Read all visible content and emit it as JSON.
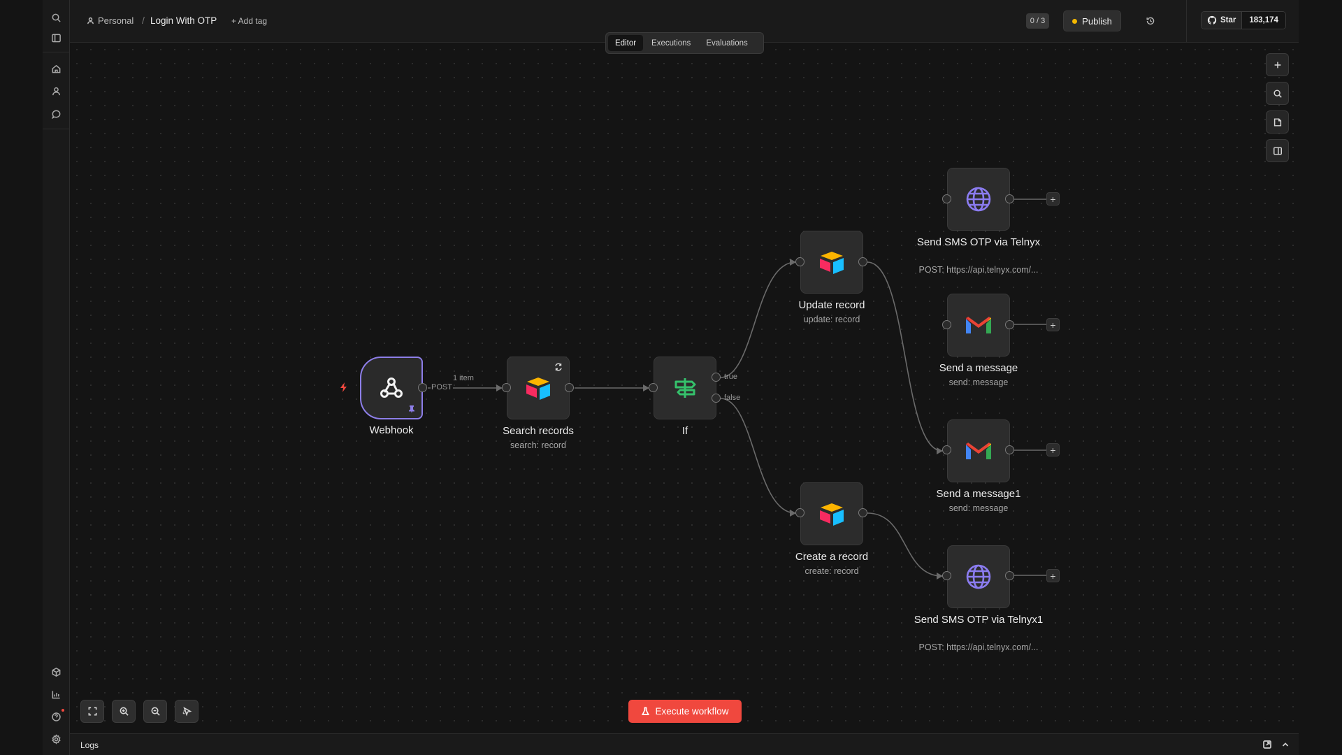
{
  "header": {
    "project": "Personal",
    "workflow_name": "Login With OTP",
    "add_tag": "+ Add tag",
    "counter": "0 / 3",
    "publish_label": "Publish",
    "github_star": "Star",
    "github_count": "183,174"
  },
  "tabs": [
    "Editor",
    "Executions",
    "Evaluations"
  ],
  "active_tab": "Editor",
  "nodes": {
    "webhook": {
      "title": "Webhook",
      "icon": "webhook-icon"
    },
    "search": {
      "title": "Search records",
      "subtitle": "search: record",
      "icon": "airtable-icon"
    },
    "if": {
      "title": "If",
      "icon": "signpost-icon"
    },
    "update": {
      "title": "Update record",
      "subtitle": "update: record",
      "icon": "airtable-icon"
    },
    "create": {
      "title": "Create a record",
      "subtitle": "create: record",
      "icon": "airtable-icon"
    },
    "sms1": {
      "title": "Send SMS OTP via Telnyx",
      "subtitle": "POST: https://api.telnyx.com/...",
      "icon": "globe-icon"
    },
    "gmail1": {
      "title": "Send a message",
      "subtitle": "send: message",
      "icon": "gmail-icon"
    },
    "gmail2": {
      "title": "Send a message1",
      "subtitle": "send: message",
      "icon": "gmail-icon"
    },
    "sms2": {
      "title": "Send SMS OTP via Telnyx1",
      "subtitle": "POST: https://api.telnyx.com/...",
      "icon": "globe-icon"
    }
  },
  "edges": {
    "webhook_output": "POST",
    "webhook_items": "1 item",
    "if_true": "true",
    "if_false": "false"
  },
  "execute_label": "Execute workflow",
  "logs_label": "Logs",
  "colors": {
    "accent": "#f0483e",
    "trigger_border": "#8d7ee8",
    "publish_dot": "#f5b800",
    "if_green": "#35c16b",
    "globe_purple": "#8b7cf0"
  }
}
